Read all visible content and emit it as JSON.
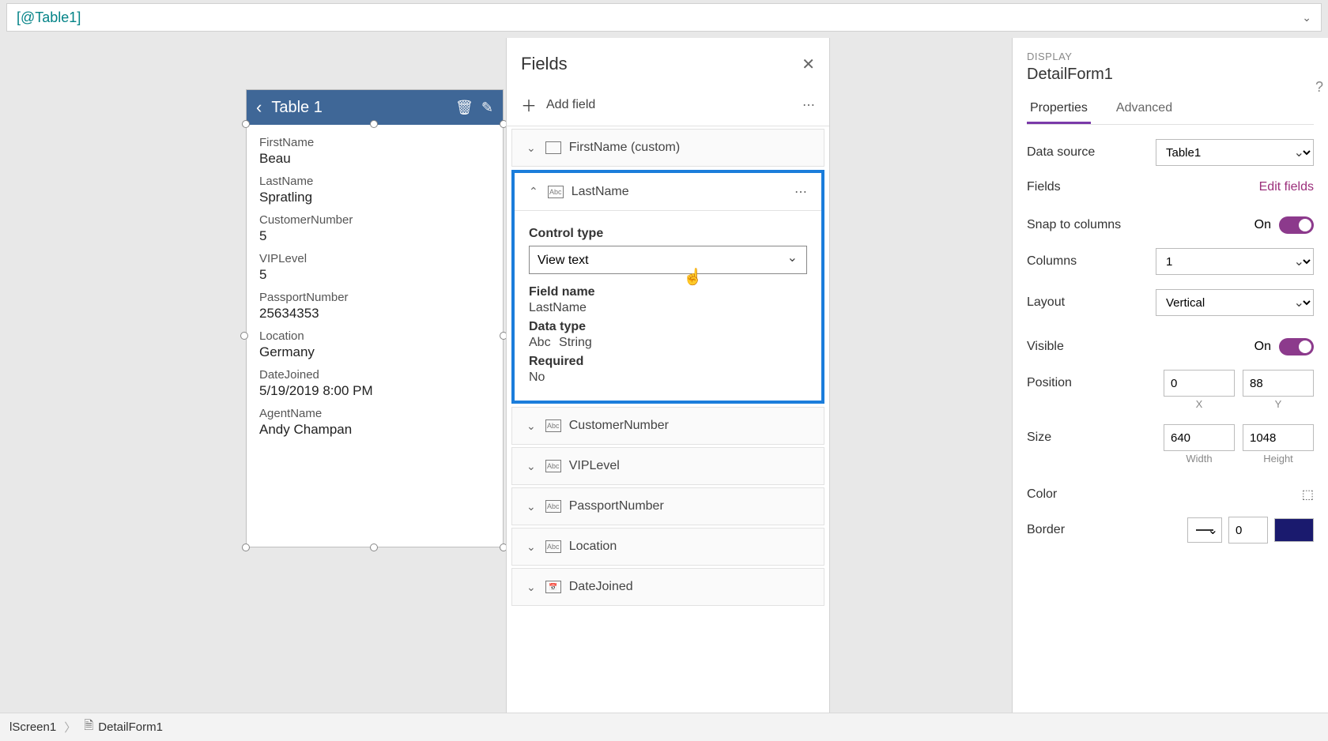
{
  "formula_bar": "[@Table1]",
  "form_card": {
    "title": "Table 1",
    "fields": [
      {
        "label": "FirstName",
        "value": "Beau"
      },
      {
        "label": "LastName",
        "value": "Spratling"
      },
      {
        "label": "CustomerNumber",
        "value": "5"
      },
      {
        "label": "VIPLevel",
        "value": "5"
      },
      {
        "label": "PassportNumber",
        "value": "25634353"
      },
      {
        "label": "Location",
        "value": "Germany"
      },
      {
        "label": "DateJoined",
        "value": "5/19/2019 8:00 PM"
      },
      {
        "label": "AgentName",
        "value": "Andy Champan"
      }
    ]
  },
  "fields_panel": {
    "title": "Fields",
    "add_field": "Add field",
    "items_before": [
      {
        "name": "FirstName (custom)",
        "icon": "rect"
      }
    ],
    "expanded": {
      "name": "LastName",
      "control_type_label": "Control type",
      "control_type_value": "View text",
      "field_name_label": "Field name",
      "field_name_value": "LastName",
      "data_type_label": "Data type",
      "data_type_value": "String",
      "required_label": "Required",
      "required_value": "No"
    },
    "items_after": [
      {
        "name": "CustomerNumber",
        "icon": "abc"
      },
      {
        "name": "VIPLevel",
        "icon": "abc"
      },
      {
        "name": "PassportNumber",
        "icon": "abc"
      },
      {
        "name": "Location",
        "icon": "abc"
      },
      {
        "name": "DateJoined",
        "icon": "date"
      }
    ]
  },
  "props_panel": {
    "section": "DISPLAY",
    "control_name": "DetailForm1",
    "tabs": {
      "properties": "Properties",
      "advanced": "Advanced"
    },
    "data_source_label": "Data source",
    "data_source_value": "Table1",
    "fields_label": "Fields",
    "edit_fields": "Edit fields",
    "snap_label": "Snap to columns",
    "snap_value": "On",
    "columns_label": "Columns",
    "columns_value": "1",
    "layout_label": "Layout",
    "layout_value": "Vertical",
    "visible_label": "Visible",
    "visible_value": "On",
    "position_label": "Position",
    "position_x": "0",
    "position_y": "88",
    "x_label": "X",
    "y_label": "Y",
    "size_label": "Size",
    "size_w": "640",
    "size_h": "1048",
    "w_label": "Width",
    "h_label": "Height",
    "color_label": "Color",
    "border_label": "Border",
    "border_value": "0"
  },
  "status_bar": {
    "screen": "lScreen1",
    "control": "DetailForm1"
  }
}
